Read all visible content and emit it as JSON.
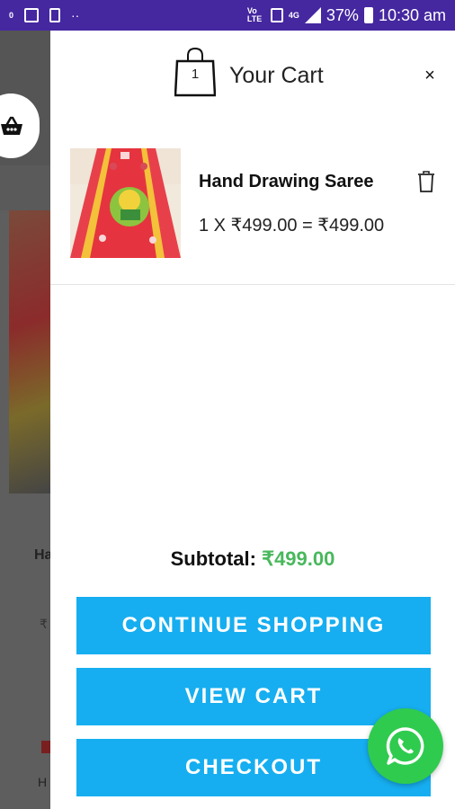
{
  "status_bar": {
    "left_icons": [
      "notification-icon",
      "image-icon",
      "gallery-icon",
      "dots-icon"
    ],
    "left_small": "0",
    "network_label": "4G",
    "volte_label": "Vo LTE",
    "battery": "37%",
    "time": "10:30 am"
  },
  "background_page": {
    "product_name_fragment": "Ha",
    "price_fragment": "₹",
    "nav_fragment": "H"
  },
  "cart": {
    "title": "Your Cart",
    "count": "1",
    "close_label": "×",
    "items": [
      {
        "name": "Hand Drawing Saree",
        "price_line": "1 X ₹499.00 = ₹499.00"
      }
    ],
    "subtotal_label": "Subtotal:",
    "subtotal_value": "₹499.00"
  },
  "buttons": {
    "continue_shopping": "CONTINUE SHOPPING",
    "view_cart": "VIEW CART",
    "checkout": "CHECKOUT"
  },
  "colors": {
    "status_bar": "#4527a0",
    "button": "#16aef0",
    "subtotal_amount": "#49b85c",
    "whatsapp": "#2fcb4f"
  }
}
